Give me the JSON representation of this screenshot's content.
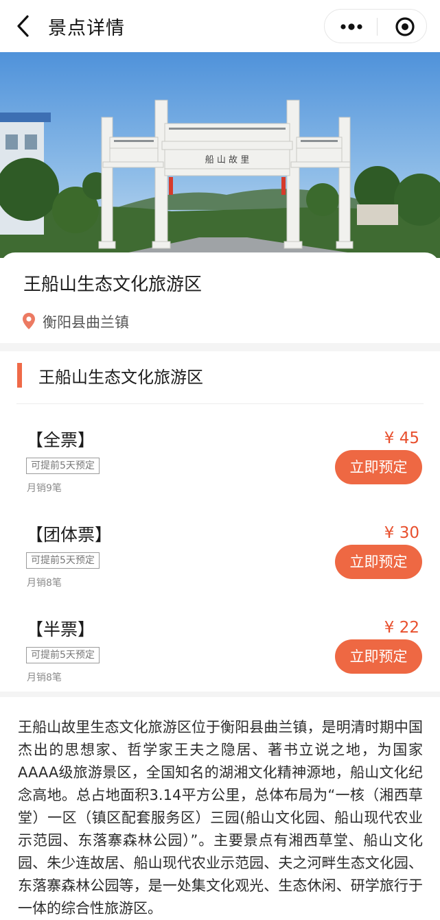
{
  "navbar": {
    "title": "景点详情"
  },
  "spot": {
    "name": "王船山生态文化旅游区",
    "location": "衡阳县曲兰镇",
    "gate_plaque": "船 山 故 里"
  },
  "tickets_section": {
    "title": "王船山生态文化旅游区",
    "items": [
      {
        "name": "【全票】",
        "tag": "可提前5天预定",
        "sales": "月销9笔",
        "price": "¥ 45",
        "button": "立即预定"
      },
      {
        "name": "【团体票】",
        "tag": "可提前5天预定",
        "sales": "月销8笔",
        "price": "¥ 30",
        "button": "立即预定"
      },
      {
        "name": "【半票】",
        "tag": "可提前5天预定",
        "sales": "月销8笔",
        "price": "¥ 22",
        "button": "立即预定"
      }
    ]
  },
  "description": "王船山故里生态文化旅游区位于衡阳县曲兰镇，是明清时期中国杰出的思想家、哲学家王夫之隐居、著书立说之地，为国家AAAA级旅游景区，全国知名的湖湘文化精神源地，船山文化纪念高地。总占地面积3.14平方公里，总体布局为“一核（湘西草堂）一区（镇区配套服务区）三园(船山文化园、船山现代农业示范园、东落寨森林公园）”。主要景点有湘西草堂、船山文化园、朱少连故居、船山现代农业示范园、夫之河畔生态文化园、东落寨森林公园等，是一处集文化观光、生态休闲、研学旅行于一体的综合性旅游区。",
  "colors": {
    "accent": "#ee6843",
    "price": "#e8502e",
    "sky": "#5d9ce0"
  },
  "icons": {
    "back": "chevron-left-icon",
    "more": "more-dots-icon",
    "close": "target-circle-icon",
    "location": "location-pin-icon"
  }
}
